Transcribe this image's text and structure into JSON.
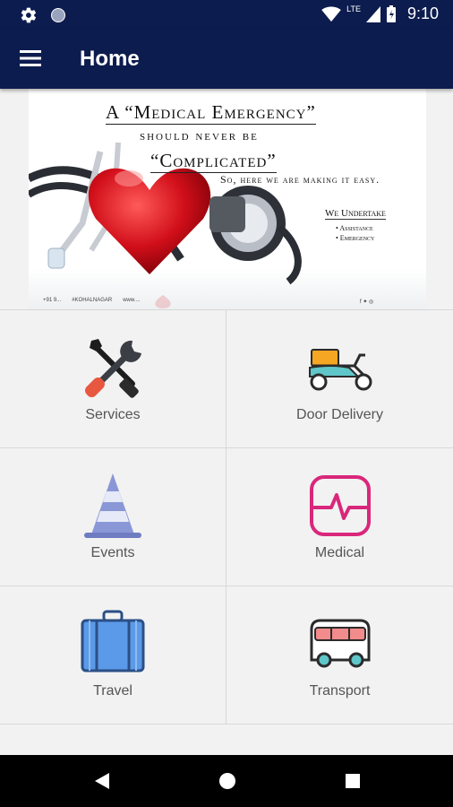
{
  "status_bar": {
    "time": "9:10",
    "network": "LTE"
  },
  "app_bar": {
    "title": "Home"
  },
  "banner": {
    "line1": "A “Medical Emergency”",
    "line2": "should never be",
    "line3": "“Complicated”",
    "line4": "So, here we are making it easy.",
    "undertake_title": "We Undertake",
    "undertake_items": [
      "• Assistance",
      "• Emergency"
    ],
    "contact_phone": "+91 9...",
    "contact_handle": "#KOHALNAGAR",
    "contact_web": "www...."
  },
  "tiles": [
    {
      "label": "Services",
      "icon": "tools-icon"
    },
    {
      "label": "Door Delivery",
      "icon": "scooter-icon"
    },
    {
      "label": "Events",
      "icon": "cone-icon"
    },
    {
      "label": "Medical",
      "icon": "heartbeat-icon"
    },
    {
      "label": "Travel",
      "icon": "suitcase-icon"
    },
    {
      "label": "Transport",
      "icon": "bus-icon"
    }
  ],
  "colors": {
    "app_bar": "#0d1c4e",
    "medical_accent": "#d9277b",
    "events_accent": "#8a97d6",
    "travel_accent": "#4d8fe0"
  }
}
